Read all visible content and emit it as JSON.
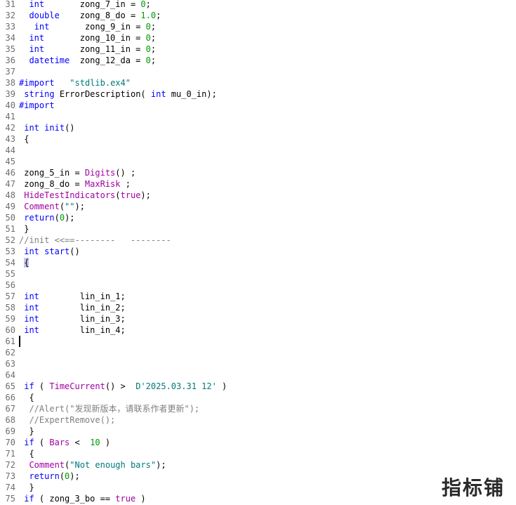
{
  "lines": [
    {
      "n": "31",
      "parts": [
        {
          "t": "  "
        },
        {
          "t": "int",
          "c": "kw"
        },
        {
          "t": "       zong_7_in = "
        },
        {
          "t": "0",
          "c": "num"
        },
        {
          "t": ";"
        }
      ]
    },
    {
      "n": "32",
      "parts": [
        {
          "t": "  "
        },
        {
          "t": "double",
          "c": "kw"
        },
        {
          "t": "    zong_8_do = "
        },
        {
          "t": "1.0",
          "c": "num"
        },
        {
          "t": ";"
        }
      ]
    },
    {
      "n": "33",
      "parts": [
        {
          "t": "   "
        },
        {
          "t": "int",
          "c": "kw"
        },
        {
          "t": "       zong_9_in = "
        },
        {
          "t": "0",
          "c": "num"
        },
        {
          "t": ";"
        }
      ]
    },
    {
      "n": "34",
      "parts": [
        {
          "t": "  "
        },
        {
          "t": "int",
          "c": "kw"
        },
        {
          "t": "       zong_10_in = "
        },
        {
          "t": "0",
          "c": "num"
        },
        {
          "t": ";"
        }
      ]
    },
    {
      "n": "35",
      "parts": [
        {
          "t": "  "
        },
        {
          "t": "int",
          "c": "kw"
        },
        {
          "t": "       zong_11_in = "
        },
        {
          "t": "0",
          "c": "num"
        },
        {
          "t": ";"
        }
      ]
    },
    {
      "n": "36",
      "parts": [
        {
          "t": "  "
        },
        {
          "t": "datetime",
          "c": "kw"
        },
        {
          "t": "  zong_12_da = "
        },
        {
          "t": "0",
          "c": "num"
        },
        {
          "t": ";"
        }
      ]
    },
    {
      "n": "37",
      "parts": []
    },
    {
      "n": "38",
      "parts": [
        {
          "t": "#import",
          "c": "kw"
        },
        {
          "t": "   "
        },
        {
          "t": "\"stdlib.ex4\"",
          "c": "str"
        }
      ]
    },
    {
      "n": "39",
      "parts": [
        {
          "t": " "
        },
        {
          "t": "string",
          "c": "kw"
        },
        {
          "t": " ErrorDescription( "
        },
        {
          "t": "int",
          "c": "kw"
        },
        {
          "t": " mu_0_in);"
        }
      ]
    },
    {
      "n": "40",
      "parts": [
        {
          "t": "#import",
          "c": "kw"
        }
      ]
    },
    {
      "n": "41",
      "parts": []
    },
    {
      "n": "42",
      "parts": [
        {
          "t": " "
        },
        {
          "t": "int",
          "c": "kw"
        },
        {
          "t": " "
        },
        {
          "t": "init",
          "c": "kw"
        },
        {
          "t": "()"
        }
      ]
    },
    {
      "n": "43",
      "parts": [
        {
          "t": " {"
        }
      ]
    },
    {
      "n": "44",
      "parts": []
    },
    {
      "n": "45",
      "parts": []
    },
    {
      "n": "46",
      "parts": [
        {
          "t": " zong_5_in = "
        },
        {
          "t": "Digits",
          "c": "fn"
        },
        {
          "t": "() ;"
        }
      ]
    },
    {
      "n": "47",
      "parts": [
        {
          "t": " zong_8_do = "
        },
        {
          "t": "MaxRisk",
          "c": "fn"
        },
        {
          "t": " ;"
        }
      ]
    },
    {
      "n": "48",
      "parts": [
        {
          "t": " "
        },
        {
          "t": "HideTestIndicators",
          "c": "fn"
        },
        {
          "t": "("
        },
        {
          "t": "true",
          "c": "fn"
        },
        {
          "t": ");"
        }
      ]
    },
    {
      "n": "49",
      "parts": [
        {
          "t": " "
        },
        {
          "t": "Comment",
          "c": "fn"
        },
        {
          "t": "("
        },
        {
          "t": "\"\"",
          "c": "str"
        },
        {
          "t": ");"
        }
      ]
    },
    {
      "n": "50",
      "parts": [
        {
          "t": " "
        },
        {
          "t": "return",
          "c": "kw"
        },
        {
          "t": "("
        },
        {
          "t": "0",
          "c": "num"
        },
        {
          "t": ");"
        }
      ]
    },
    {
      "n": "51",
      "parts": [
        {
          "t": " }"
        }
      ]
    },
    {
      "n": "52",
      "parts": [
        {
          "t": "//init <<==--------   --------",
          "c": "com"
        }
      ]
    },
    {
      "n": "53",
      "parts": [
        {
          "t": " "
        },
        {
          "t": "int",
          "c": "kw"
        },
        {
          "t": " "
        },
        {
          "t": "start",
          "c": "kw"
        },
        {
          "t": "()"
        }
      ]
    },
    {
      "n": "54",
      "parts": [
        {
          "t": " "
        },
        {
          "t": "{",
          "c": "hl"
        }
      ]
    },
    {
      "n": "55",
      "parts": []
    },
    {
      "n": "56",
      "parts": []
    },
    {
      "n": "57",
      "parts": [
        {
          "t": " "
        },
        {
          "t": "int",
          "c": "kw"
        },
        {
          "t": "        lin_in_1;"
        }
      ]
    },
    {
      "n": "58",
      "parts": [
        {
          "t": " "
        },
        {
          "t": "int",
          "c": "kw"
        },
        {
          "t": "        lin_in_2;"
        }
      ]
    },
    {
      "n": "59",
      "parts": [
        {
          "t": " "
        },
        {
          "t": "int",
          "c": "kw"
        },
        {
          "t": "        lin_in_3;"
        }
      ]
    },
    {
      "n": "60",
      "parts": [
        {
          "t": " "
        },
        {
          "t": "int",
          "c": "kw"
        },
        {
          "t": "        lin_in_4;"
        }
      ]
    },
    {
      "n": "61",
      "parts": []
    },
    {
      "n": "62",
      "parts": []
    },
    {
      "n": "63",
      "parts": []
    },
    {
      "n": "64",
      "parts": []
    },
    {
      "n": "65",
      "parts": [
        {
          "t": " "
        },
        {
          "t": "if",
          "c": "kw"
        },
        {
          "t": " ( "
        },
        {
          "t": "TimeCurrent",
          "c": "fn"
        },
        {
          "t": "() >  "
        },
        {
          "t": "D'2025.03.31 12'",
          "c": "dt"
        },
        {
          "t": " )"
        }
      ]
    },
    {
      "n": "66",
      "parts": [
        {
          "t": "  {"
        }
      ]
    },
    {
      "n": "67",
      "parts": [
        {
          "t": "  "
        },
        {
          "t": "//Alert(\"发现新版本，请联系作者更新\");",
          "c": "com"
        }
      ]
    },
    {
      "n": "68",
      "parts": [
        {
          "t": "  "
        },
        {
          "t": "//ExpertRemove();",
          "c": "com"
        }
      ]
    },
    {
      "n": "69",
      "parts": [
        {
          "t": "  }"
        }
      ]
    },
    {
      "n": "70",
      "parts": [
        {
          "t": " "
        },
        {
          "t": "if",
          "c": "kw"
        },
        {
          "t": " ( "
        },
        {
          "t": "Bars",
          "c": "fn"
        },
        {
          "t": " <  "
        },
        {
          "t": "10",
          "c": "num"
        },
        {
          "t": " )"
        }
      ]
    },
    {
      "n": "71",
      "parts": [
        {
          "t": "  {"
        }
      ]
    },
    {
      "n": "72",
      "parts": [
        {
          "t": "  "
        },
        {
          "t": "Comment",
          "c": "fn"
        },
        {
          "t": "("
        },
        {
          "t": "\"Not enough bars\"",
          "c": "str"
        },
        {
          "t": ");"
        }
      ]
    },
    {
      "n": "73",
      "parts": [
        {
          "t": "  "
        },
        {
          "t": "return",
          "c": "kw"
        },
        {
          "t": "("
        },
        {
          "t": "0",
          "c": "num"
        },
        {
          "t": ");"
        }
      ]
    },
    {
      "n": "74",
      "parts": [
        {
          "t": "  }"
        }
      ]
    },
    {
      "n": "75",
      "parts": [
        {
          "t": " "
        },
        {
          "t": "if",
          "c": "kw"
        },
        {
          "t": " ( zong_3_bo == "
        },
        {
          "t": "true",
          "c": "fn"
        },
        {
          "t": " )"
        }
      ]
    }
  ],
  "watermark": "指标铺",
  "colors": {
    "keyword": "#0000ff",
    "function": "#a000a0",
    "number": "#009900",
    "string": "#007a7a",
    "comment": "#7f7f7f",
    "line_number": "#6e6e6e",
    "highlight": "#c8c8f0"
  }
}
